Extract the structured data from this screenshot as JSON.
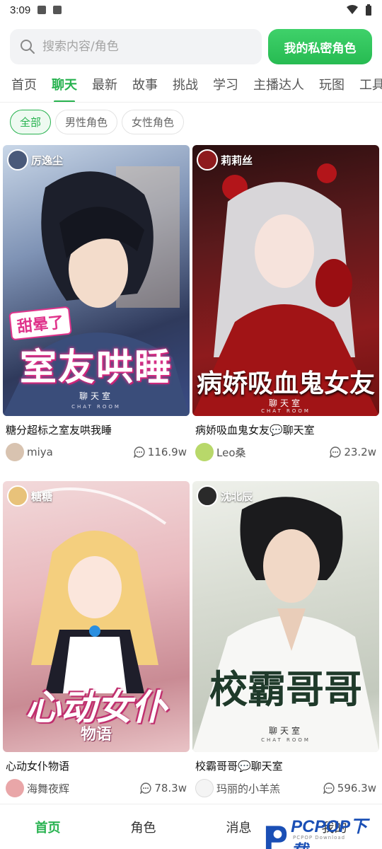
{
  "status_bar": {
    "time": "3:09"
  },
  "search": {
    "placeholder": "搜索内容/角色",
    "private_button": "我的私密角色"
  },
  "tabs": [
    "首页",
    "聊天",
    "最新",
    "故事",
    "挑战",
    "学习",
    "主播达人",
    "玩图",
    "工具"
  ],
  "active_tab": "聊天",
  "chips": [
    "全部",
    "男性角色",
    "女性角色"
  ],
  "active_chip": "全部",
  "cards": [
    {
      "cover_author": "厉逸尘",
      "cover_tag": "甜晕了",
      "cover_title": "室友哄睡",
      "cover_sub": "聊天室",
      "cover_sub2": "CHAT ROOM",
      "title": "糖分超标之室友哄我睡",
      "user": "miya",
      "count": "116.9w"
    },
    {
      "cover_author": "莉莉丝",
      "cover_title": "病娇吸血鬼女友",
      "cover_sub": "聊天室",
      "cover_sub2": "CHAT ROOM",
      "title": "病娇吸血鬼女友💬聊天室",
      "user": "Leo桑",
      "count": "23.2w"
    },
    {
      "cover_author": "糖糖",
      "cover_title": "心动女仆",
      "cover_tag": "物语",
      "title": "心动女仆物语",
      "user": "海舞夜辉",
      "count": "78.3w"
    },
    {
      "cover_author": "沈北辰",
      "cover_title": "校霸哥哥",
      "cover_sub": "聊天室",
      "cover_sub2": "CHAT ROOM",
      "title": "校霸哥哥💬聊天室",
      "user": "玛丽的小羊羔",
      "count": "596.3w"
    }
  ],
  "bottom_nav": [
    "首页",
    "角色",
    "消息",
    "我的"
  ],
  "watermark": {
    "text": "PCPOP下载",
    "sub": "PCPOP Download"
  },
  "colors": {
    "accent": "#27b24f"
  }
}
